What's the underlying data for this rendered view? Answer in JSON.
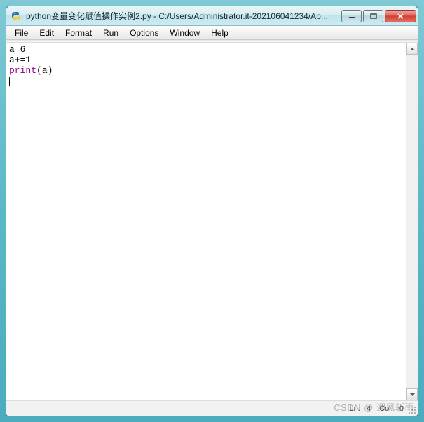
{
  "titlebar": {
    "title": "python变量变化赋值操作实例2.py - C:/Users/Administrator.it-202106041234/Ap..."
  },
  "menu": {
    "items": [
      "File",
      "Edit",
      "Format",
      "Run",
      "Options",
      "Window",
      "Help"
    ]
  },
  "editor": {
    "lines": [
      {
        "segments": [
          {
            "text": "a=6",
            "cls": ""
          }
        ]
      },
      {
        "segments": [
          {
            "text": "a+=1",
            "cls": ""
          }
        ]
      },
      {
        "segments": [
          {
            "text": "print",
            "cls": "kw-purple"
          },
          {
            "text": "(a)",
            "cls": ""
          }
        ]
      },
      {
        "segments": [],
        "cursor": true
      }
    ]
  },
  "status": {
    "ln_label": "Ln:",
    "ln_value": "4",
    "col_label": "Col:",
    "col_value": "0"
  },
  "watermark": "CSDN @ 迎风斩雨"
}
